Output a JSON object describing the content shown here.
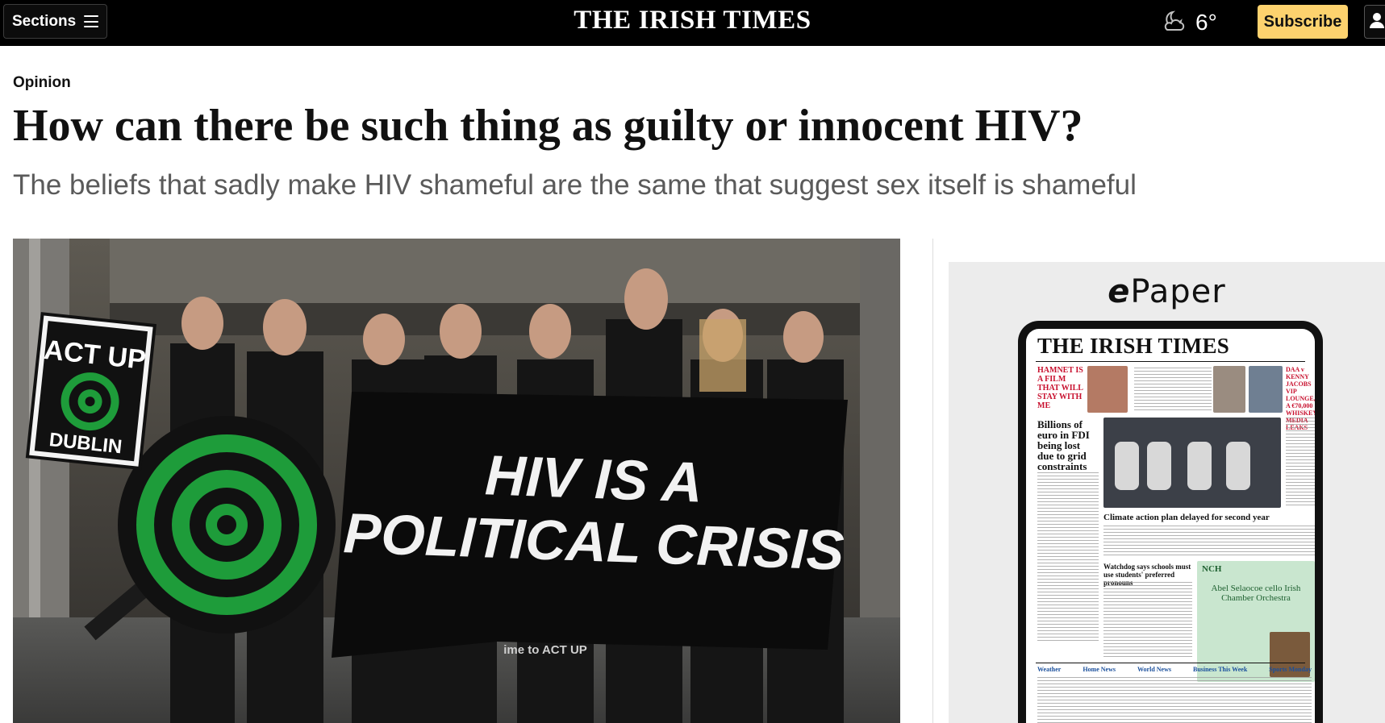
{
  "header": {
    "sections_label": "Sections",
    "masthead": "THE IRISH TIMES",
    "temperature": "6°",
    "weather_icon": "moon-cloud-icon",
    "subscribe_label": "Subscribe",
    "account_icon": "user-icon"
  },
  "article": {
    "kicker": "Opinion",
    "headline": "How can there be such thing as guilty or innocent HIV?",
    "standfirst": "The beliefs that sadly make HIV shameful are the same that suggest sex itself is shameful"
  },
  "hero_image": {
    "banner_line1": "HIV IS A",
    "banner_line2": "POLITICAL CRISIS",
    "placard_top": "ACT UP",
    "placard_bottom": "DUBLIN",
    "banner_footer": "ime to ACT UP"
  },
  "epaper": {
    "title_e": "e",
    "title_rest": "Paper",
    "masthead": "THE IRISH TIMES",
    "story1": "HAMNET IS A FILM THAT WILL STAY WITH ME",
    "story2": "Billions of euro in FDI being lost due to grid constraints",
    "story3": "Climate action plan delayed for second year",
    "story4": "Watchdog says schools must use students' preferred pronouns",
    "story5": "DAA v KENNY JACOBS VIP LOUNGE, A €70,000 WHISKEY, MEDIA LEAKS",
    "ad_org": "NCH",
    "ad_title": "Abel Selaocoe cello Irish Chamber Orchestra",
    "footer_items": [
      "Weather",
      "Home News",
      "World News",
      "Business This Week",
      "Sports Monday"
    ]
  },
  "colors": {
    "topbar": "#000000",
    "subscribe": "#fdd26e",
    "standfirst": "#5a5a5a",
    "epaper_bg": "#ececec",
    "target_green": "#1e9c3a"
  }
}
